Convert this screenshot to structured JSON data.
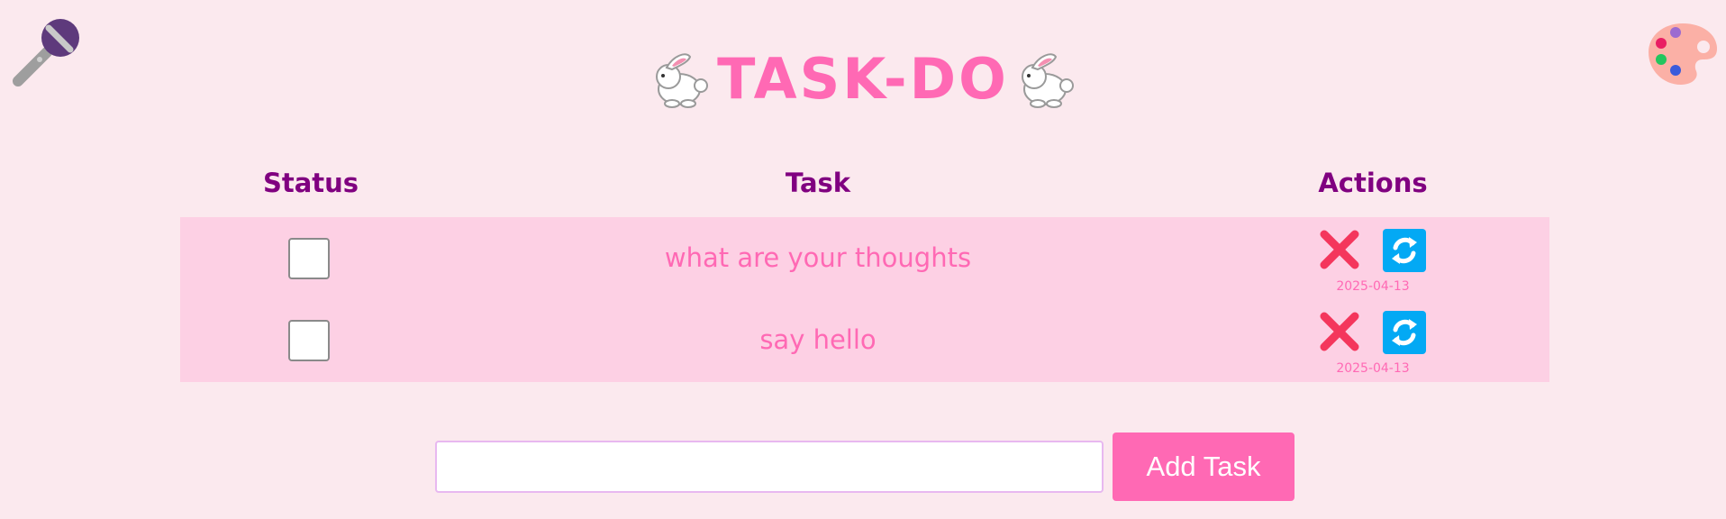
{
  "app": {
    "title": "TASK-DO"
  },
  "icons": {
    "left": "microphone-icon",
    "right": "palette-icon",
    "title_decoration": "rabbit-icon",
    "delete": "cross-mark-icon",
    "update": "refresh-icon"
  },
  "table": {
    "headers": {
      "status": "Status",
      "task": "Task",
      "actions": "Actions"
    },
    "rows": [
      {
        "task": "what are your thoughts",
        "done": false,
        "date": "2025-04-13"
      },
      {
        "task": "say hello",
        "done": false,
        "date": "2025-04-13"
      }
    ]
  },
  "form": {
    "input_value": "",
    "input_placeholder": "",
    "add_label": "Add Task"
  },
  "colors": {
    "background": "#fbe9ee",
    "accent_pink": "#ff69b4",
    "header_purple": "#800080",
    "row_background": "#fdd0e4",
    "delete_red": "#f4365c",
    "update_blue": "#03a9f4",
    "input_border": "#e8b8f0"
  }
}
